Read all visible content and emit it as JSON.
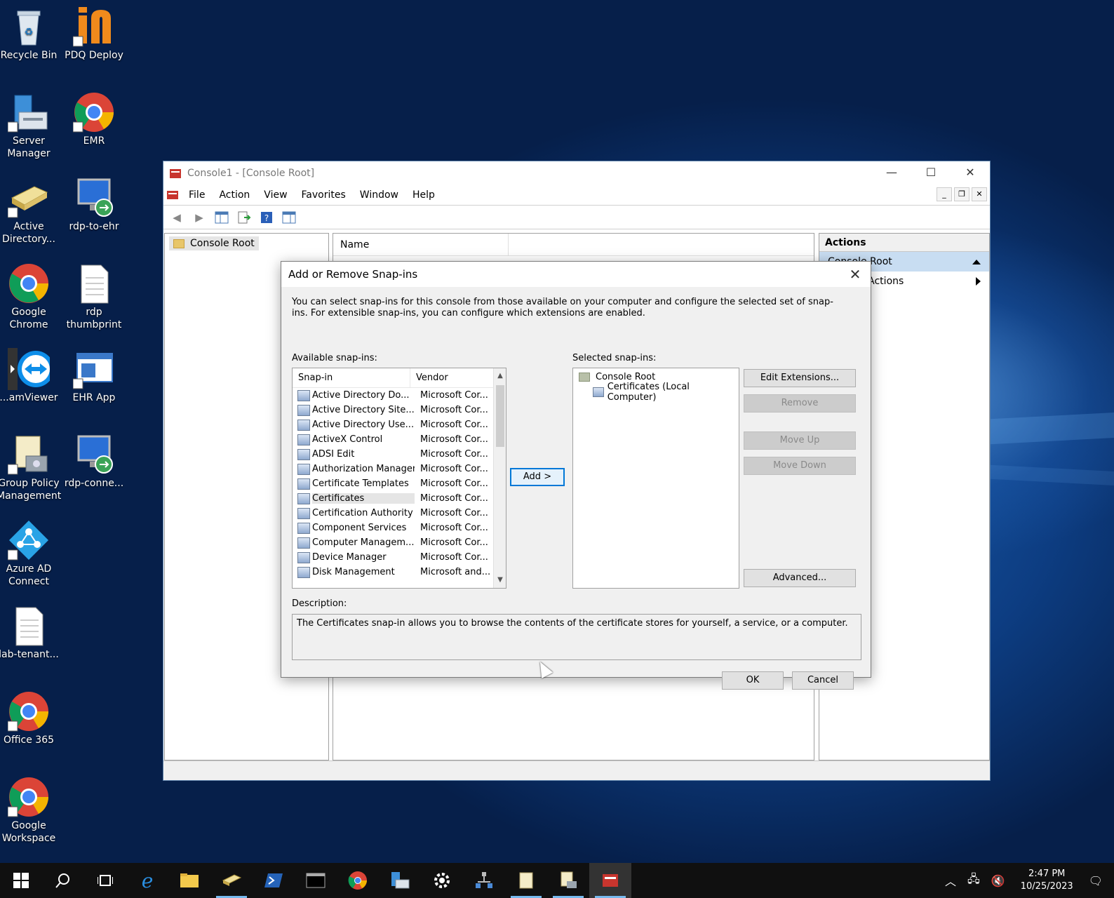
{
  "desktop": {
    "icons": [
      {
        "label": "Recycle Bin",
        "icon": "recycle-bin-icon"
      },
      {
        "label": "PDQ Deploy",
        "icon": "pdq-deploy-icon"
      },
      {
        "label": "Server Manager",
        "icon": "server-manager-icon"
      },
      {
        "label": "EMR",
        "icon": "chrome-icon"
      },
      {
        "label": "Active Directory...",
        "icon": "active-directory-icon"
      },
      {
        "label": "rdp-to-ehr",
        "icon": "remote-desktop-icon"
      },
      {
        "label": "Google Chrome",
        "icon": "chrome-icon"
      },
      {
        "label": "rdp thumbprint",
        "icon": "text-file-icon"
      },
      {
        "label": "...amViewer",
        "icon": "teamviewer-icon"
      },
      {
        "label": "EHR App",
        "icon": "app-window-icon"
      },
      {
        "label": "Group Policy Management",
        "icon": "group-policy-icon"
      },
      {
        "label": "rdp-conne...",
        "icon": "remote-desktop-icon"
      },
      {
        "label": "Azure AD Connect",
        "icon": "azure-ad-icon"
      },
      {
        "label": "lab-tenant...",
        "icon": "text-file-icon"
      },
      {
        "label": "Office 365",
        "icon": "chrome-icon"
      },
      {
        "label": "Google Workspace",
        "icon": "chrome-icon"
      }
    ]
  },
  "mmc": {
    "title": "Console1 - [Console Root]",
    "menu": [
      "File",
      "Action",
      "View",
      "Favorites",
      "Window",
      "Help"
    ],
    "tree_root": "Console Root",
    "list_header": "Name",
    "actions": {
      "header": "Actions",
      "section": "Console Root",
      "item": "More Actions"
    }
  },
  "dialog": {
    "title": "Add or Remove Snap-ins",
    "intro": "You can select snap-ins for this console from those available on your computer and configure the selected set of snap-ins. For extensible snap-ins, you can configure which extensions are enabled.",
    "available_label": "Available snap-ins:",
    "selected_label": "Selected snap-ins:",
    "columns": {
      "snapin": "Snap-in",
      "vendor": "Vendor"
    },
    "snapins": [
      {
        "name": "Active Directory Do...",
        "vendor": "Microsoft Cor..."
      },
      {
        "name": "Active Directory Site...",
        "vendor": "Microsoft Cor..."
      },
      {
        "name": "Active Directory Use...",
        "vendor": "Microsoft Cor..."
      },
      {
        "name": "ActiveX Control",
        "vendor": "Microsoft Cor..."
      },
      {
        "name": "ADSI Edit",
        "vendor": "Microsoft Cor..."
      },
      {
        "name": "Authorization Manager",
        "vendor": "Microsoft Cor..."
      },
      {
        "name": "Certificate Templates",
        "vendor": "Microsoft Cor..."
      },
      {
        "name": "Certificates",
        "vendor": "Microsoft Cor..."
      },
      {
        "name": "Certification Authority",
        "vendor": "Microsoft Cor..."
      },
      {
        "name": "Component Services",
        "vendor": "Microsoft Cor..."
      },
      {
        "name": "Computer Managem...",
        "vendor": "Microsoft Cor..."
      },
      {
        "name": "Device Manager",
        "vendor": "Microsoft Cor..."
      },
      {
        "name": "Disk Management",
        "vendor": "Microsoft and..."
      }
    ],
    "selected_tree": {
      "root": "Console Root",
      "child": "Certificates (Local Computer)"
    },
    "buttons": {
      "add": "Add >",
      "edit_extensions": "Edit Extensions...",
      "remove": "Remove",
      "move_up": "Move Up",
      "move_down": "Move Down",
      "advanced": "Advanced...",
      "ok": "OK",
      "cancel": "Cancel"
    },
    "description_label": "Description:",
    "description": "The Certificates snap-in allows you to browse the contents of the certificate stores for yourself, a service, or a computer."
  },
  "taskbar": {
    "time": "2:47 PM",
    "date": "10/25/2023"
  }
}
